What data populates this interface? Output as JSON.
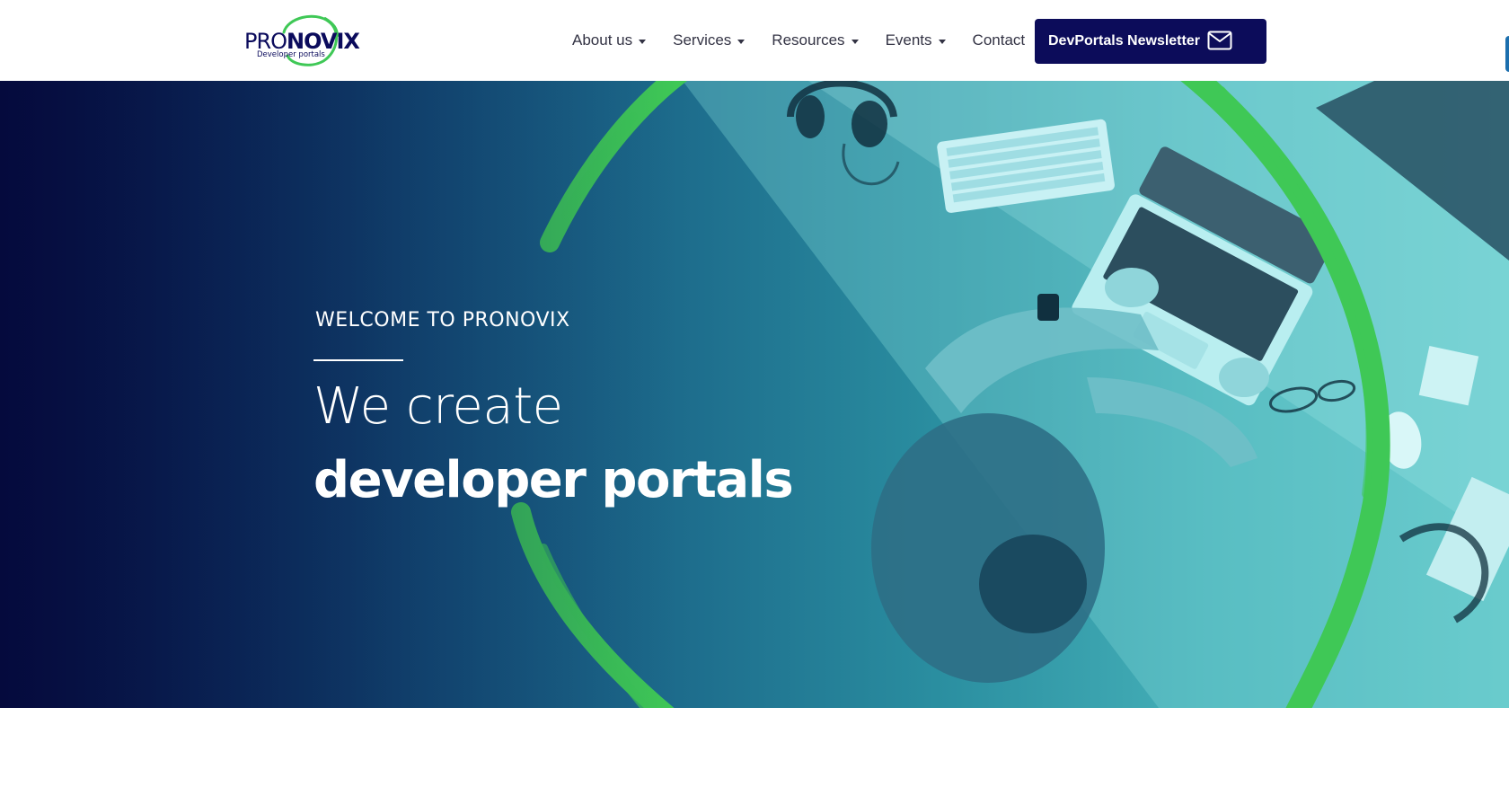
{
  "logo": {
    "pro": "PRO",
    "novix": "NOVIX",
    "tagline": "Developer portals"
  },
  "nav": {
    "items": [
      {
        "label": "About us",
        "dropdown": true
      },
      {
        "label": "Services",
        "dropdown": true
      },
      {
        "label": "Resources",
        "dropdown": true
      },
      {
        "label": "Events",
        "dropdown": true
      },
      {
        "label": "Contact",
        "dropdown": false
      }
    ],
    "newsletter_label": "DevPortals Newsletter",
    "newsletter_icon": "mail-icon"
  },
  "hero": {
    "eyebrow": "WELCOME TO PRONOVIX",
    "line1": "We create",
    "line2": "developer portals"
  },
  "colors": {
    "brand_navy": "#0c0c5a",
    "accent_green": "#3fc856",
    "hero_dark": "#050a3d",
    "hero_teal": "#5fc6c8"
  }
}
